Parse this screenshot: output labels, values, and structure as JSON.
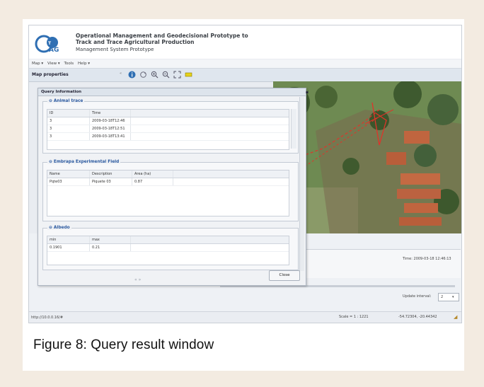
{
  "app": {
    "title_line1": "Operational Management and Geodecisional Prototype to",
    "title_line2": "Track and Trace Agricultural Production",
    "subtitle": "Management System Prototype",
    "logo_text": "OTAG"
  },
  "menu": {
    "items": [
      "Map ▾",
      "View ▾",
      "Tools",
      "Help ▾"
    ]
  },
  "panel": {
    "title": "Map properties"
  },
  "dialog": {
    "title": "Query Information",
    "animal_trace": {
      "title": "Animal trace",
      "columns": [
        "ID",
        "Time"
      ],
      "rows": [
        [
          "3",
          "2009-03-18T12:46"
        ],
        [
          "3",
          "2009-03-18T12:51"
        ],
        [
          "3",
          "2009-03-18T13:41"
        ]
      ]
    },
    "field": {
      "title": "Embrapa Experimental Field",
      "columns": [
        "Name",
        "Description",
        "Area (ha)"
      ],
      "rows": [
        [
          "Pqte03",
          "Piquete 03",
          "0.87"
        ]
      ]
    },
    "albedo": {
      "title": "Albedo",
      "columns": [
        "min",
        "max"
      ],
      "rows": [
        [
          "0.1901",
          "0.21"
        ]
      ]
    },
    "close_label": "Close",
    "pager": "« »"
  },
  "lower": {
    "time_text": "Time: 2009-03-18 12:46:13",
    "update_label": "Update interval:",
    "update_value": "2"
  },
  "status": {
    "url": "http://10.0.0.16/#",
    "scale": "Scale = 1 : 1221",
    "coords": "-54.72304, -20.44342"
  },
  "caption": "Figure 8: Query result window",
  "colors": {
    "accent": "#2c5aa0",
    "map_vegetation": "#6f8a55",
    "roof": "#c0653f",
    "track": "#e0342a"
  }
}
